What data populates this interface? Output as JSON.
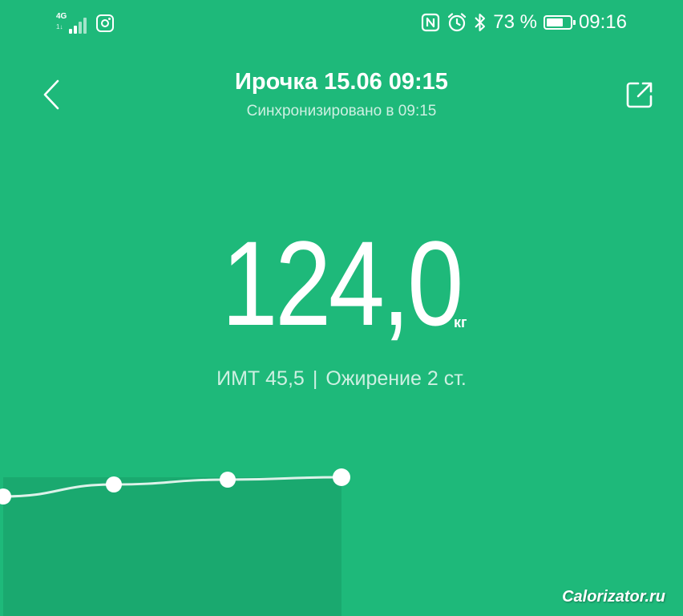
{
  "status_bar": {
    "network": "4G",
    "network_sub": "1↓",
    "battery_text": "73 %",
    "battery_level": 0.73,
    "time": "09:16",
    "left_icons": [
      "signal-icon",
      "instagram-icon"
    ],
    "right_icons": [
      "nfc-icon",
      "alarm-icon",
      "bluetooth-icon",
      "battery-icon"
    ]
  },
  "header": {
    "title": "Ирочка 15.06 09:15",
    "subtitle": "Синхронизировано в 09:15",
    "back_icon": "chevron-left-icon",
    "share_icon": "share-icon"
  },
  "measurement": {
    "value": "124,0",
    "unit": "кг",
    "bmi_label": "ИМТ 45,5",
    "separator": "|",
    "category": "Ожирение 2 ст."
  },
  "chart_data": {
    "type": "line",
    "values": [
      123.2,
      123.7,
      123.9,
      124.0
    ],
    "highlight_index": 3
  },
  "watermark": "Calorizator.ru",
  "colors": {
    "background": "#1eb97a",
    "chart_area": "#1aa96f",
    "text": "#ffffff"
  }
}
